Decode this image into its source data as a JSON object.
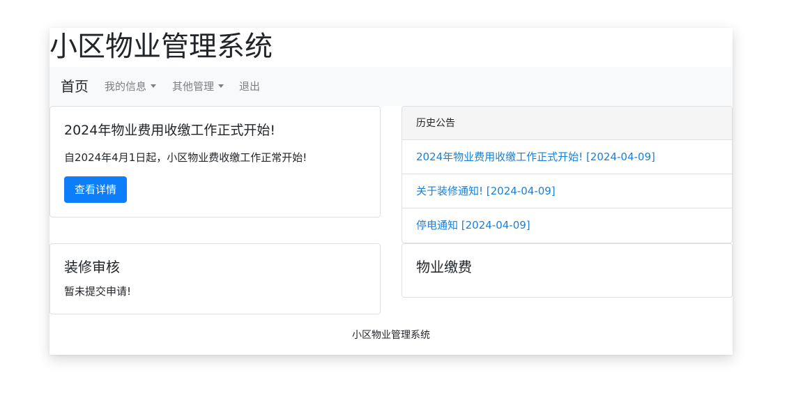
{
  "site": {
    "title": "小区物业管理系统"
  },
  "navbar": {
    "brand": "首页",
    "items": [
      {
        "label": "我的信息"
      },
      {
        "label": "其他管理"
      },
      {
        "label": "退出"
      }
    ]
  },
  "announcement_card": {
    "title": "2024年物业费用收缴工作正式开始!",
    "text": "自2024年4月1日起，小区物业费收缴工作正常开始!",
    "button": "查看详情"
  },
  "history": {
    "header": "历史公告",
    "items": [
      {
        "label": "2024年物业费用收缴工作正式开始!   [2024-04-09]"
      },
      {
        "label": "关于装修通知!   [2024-04-09]"
      },
      {
        "label": "停电通知 [2024-04-09]"
      }
    ]
  },
  "renovation_card": {
    "title": "装修审核",
    "text": "暂未提交申请!"
  },
  "fee_card": {
    "title": "物业缴费"
  },
  "footer": {
    "text": "小区物业管理系统"
  },
  "colors": {
    "primary": "#0d7dfa",
    "link": "#1a7fd6",
    "navbar_bg": "#f8f9fa",
    "border": "#dfdfdf"
  }
}
